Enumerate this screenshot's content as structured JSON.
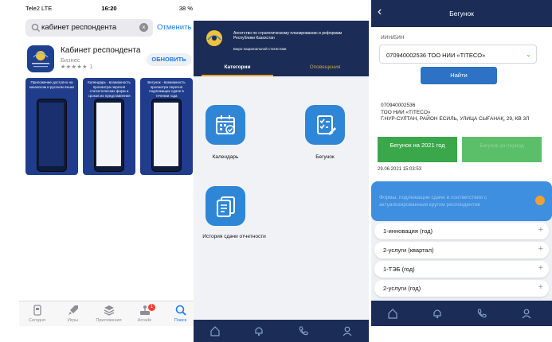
{
  "screen1": {
    "status": {
      "carrier": "Tele2 LTE",
      "time": "16:20",
      "battery": "38 %"
    },
    "search": {
      "query": "кабинет респондента",
      "cancel_label": "Отменить"
    },
    "app": {
      "name": "Кабинет респондента",
      "category": "Бизнес",
      "stars": "★★★★★ 1",
      "get_label": "ОБНОВИТЬ",
      "icon_text": "КАБИНЕТ РЕСПОНДЕНТА"
    },
    "screenshots": [
      {
        "caption": "Приложение доступно на казахском и русском языке"
      },
      {
        "caption": "Календарь - возможность просмотра перечня статистических форм и сроков их представления"
      },
      {
        "caption": "Бегунок - возможность просмотра перечня подлежащих сдаче в течении года"
      }
    ],
    "tabs": [
      {
        "label": "Сегодня",
        "icon": "today-icon"
      },
      {
        "label": "Игры",
        "icon": "rocket-icon"
      },
      {
        "label": "Приложения",
        "icon": "layers-icon"
      },
      {
        "label": "Arcade",
        "icon": "arcade-icon",
        "badge": "1"
      },
      {
        "label": "Поиск",
        "icon": "search-icon"
      }
    ]
  },
  "screen2": {
    "header": {
      "line1": "Агентство по стратегическому планированию и реформам Республики Казахстан",
      "line2": "Бюро национальной статистики"
    },
    "tabs": {
      "active": "Категории",
      "inactive": "Оповещения"
    },
    "categories": [
      {
        "label": "Календарь",
        "icon": "calendar-icon"
      },
      {
        "label": "Бегунок",
        "icon": "checklist-icon"
      },
      {
        "label": "История сдачи отчетности",
        "icon": "documents-icon"
      }
    ],
    "bottom_icons": [
      "home-icon",
      "bell-icon",
      "phone-icon",
      "user-icon"
    ]
  },
  "screen3": {
    "title": "Бегунок",
    "field_label": "ИИН/БИН",
    "select_value": "070940002536 ТОО НИИ «TITECO»",
    "find_label": "Найти",
    "info": {
      "line1": "070940002536",
      "line2": "ТОО НИИ «TITECO»",
      "line3": "Г.НУР-СУЛТАН, РАЙОН ЕСИЛЬ, УЛИЦА СЫҒАНАҚ, 29, КВ 3Л"
    },
    "green_button": "Бегунок на 2021 год",
    "green_button_faded": "Бегунок за период",
    "date": "29.06.2021 15:03:53",
    "accordion_text": "Формы, подлежащие сдаче в соответствии с актуализированным кругом респондентов",
    "items": [
      "1-инновация (год)",
      "2-услуги (квартал)",
      "1-ТЭБ (год)",
      "2-услуги (год)"
    ],
    "bottom_icons": [
      "home-icon",
      "bell-icon",
      "phone-icon",
      "user-icon"
    ]
  },
  "colors": {
    "navy": "#1b2d57",
    "blue": "#2f86d7",
    "green": "#3aa84a",
    "ios_blue": "#1a7bf2",
    "orange": "#f0a030"
  }
}
